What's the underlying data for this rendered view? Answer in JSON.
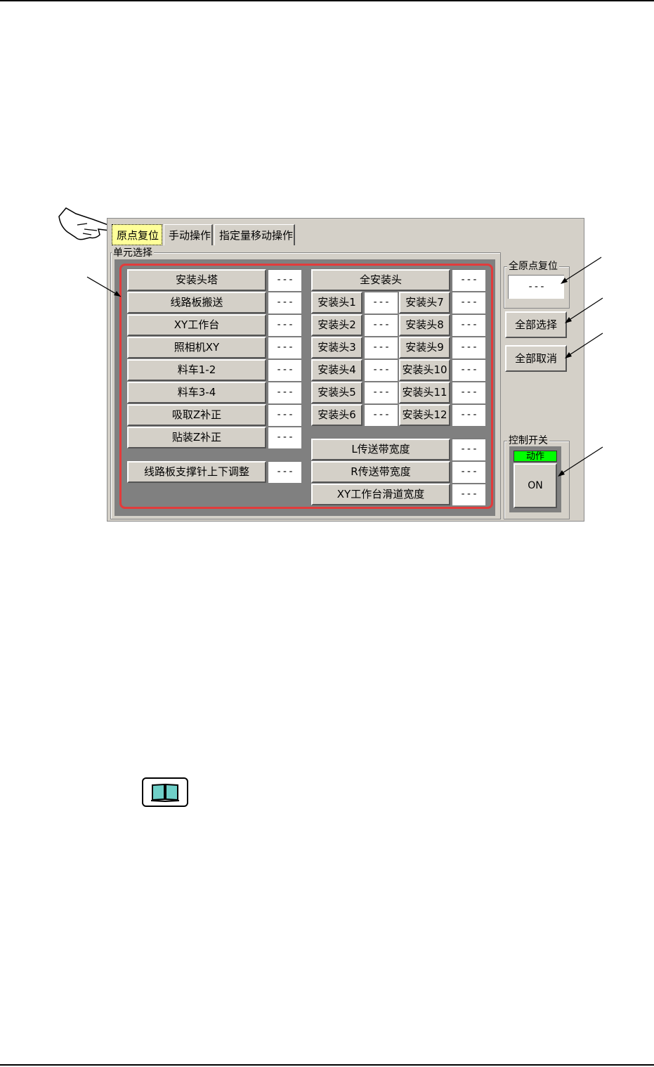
{
  "tabs": [
    "原点复位",
    "手动操作",
    "指定量移动操作"
  ],
  "unit_group_label": "单元选择",
  "left_units": [
    {
      "label": "安装头塔",
      "value": "---"
    },
    {
      "label": "线路板搬送",
      "value": "---"
    },
    {
      "label": "XY工作台",
      "value": "---"
    },
    {
      "label": "照相机XY",
      "value": "---"
    },
    {
      "label": "料车1-2",
      "value": "---"
    },
    {
      "label": "料车3-4",
      "value": "---"
    },
    {
      "label": "吸取Z补正",
      "value": "---"
    },
    {
      "label": "贴装Z补正",
      "value": "---"
    }
  ],
  "support_pin": {
    "label": "线路板支撑针上下调整",
    "value": "---"
  },
  "all_heads": {
    "label": "全安装头",
    "value": "---"
  },
  "heads": [
    {
      "label": "安装头1",
      "value": "---"
    },
    {
      "label": "安装头7",
      "value": "---"
    },
    {
      "label": "安装头2",
      "value": "---"
    },
    {
      "label": "安装头8",
      "value": "---"
    },
    {
      "label": "安装头3",
      "value": "---"
    },
    {
      "label": "安装头9",
      "value": "---"
    },
    {
      "label": "安装头4",
      "value": "---"
    },
    {
      "label": "安装头10",
      "value": "---"
    },
    {
      "label": "安装头5",
      "value": "---"
    },
    {
      "label": "安装头11",
      "value": "---"
    },
    {
      "label": "安装头6",
      "value": "---"
    },
    {
      "label": "安装头12",
      "value": "---"
    }
  ],
  "widths": [
    {
      "label": "L传送带宽度",
      "value": "---"
    },
    {
      "label": "R传送带宽度",
      "value": "---"
    },
    {
      "label": "XY工作台滑道宽度",
      "value": "---"
    }
  ],
  "all_origin": {
    "label": "全原点复位",
    "value": "---"
  },
  "select_all": "全部选择",
  "cancel_all": "全部取消",
  "control": {
    "label": "控制开关",
    "status": "动作",
    "state": "ON",
    "status_color": "#00ff00"
  }
}
